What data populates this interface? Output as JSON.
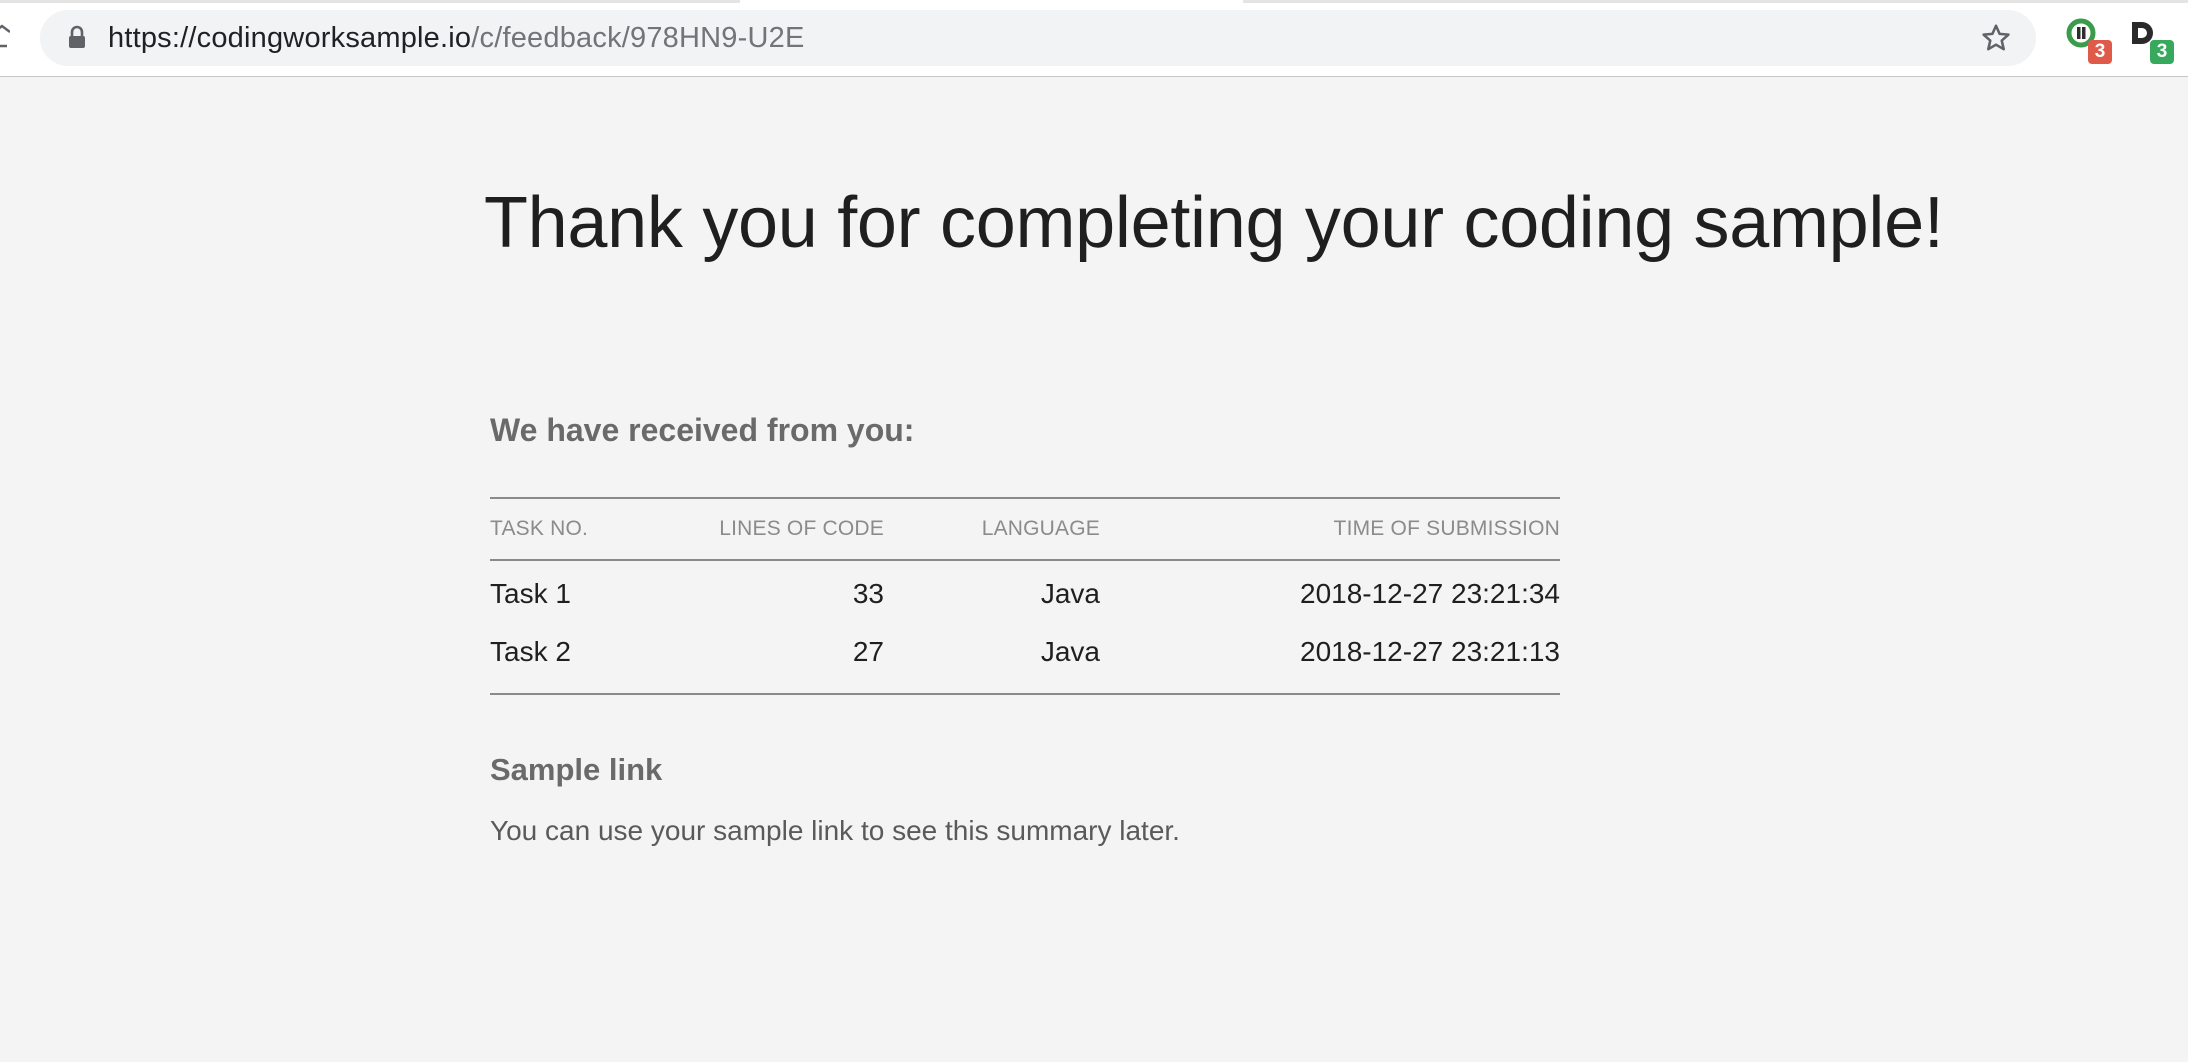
{
  "browser": {
    "url_host": "https://codingworksample.io",
    "url_path": "/c/feedback/978HN9-U2E",
    "extensions": [
      {
        "icon": "green-ring-extension-icon",
        "badge": "3",
        "badge_color": "#e05a4a"
      },
      {
        "icon": "d-extension-icon",
        "badge": "3",
        "badge_color": "#36a95d"
      }
    ]
  },
  "page": {
    "headline": "Thank you for completing your coding sample!",
    "received_heading": "We have received from you:",
    "table": {
      "headers": {
        "task": "TASK NO.",
        "lines": "LINES OF CODE",
        "language": "LANGUAGE",
        "time": "TIME OF SUBMISSION"
      },
      "rows": [
        {
          "task": "Task 1",
          "lines": "33",
          "language": "Java",
          "time": "2018-12-27 23:21:34"
        },
        {
          "task": "Task 2",
          "lines": "27",
          "language": "Java",
          "time": "2018-12-27 23:21:13"
        }
      ]
    },
    "sample_heading": "Sample link",
    "sample_text": "You can use your sample link to see this summary later."
  },
  "colors": {
    "background": "#f4f4f4",
    "omnibox": "#f1f3f4",
    "text_dark": "#1f1f1f",
    "text_muted": "#6a6a6a"
  }
}
